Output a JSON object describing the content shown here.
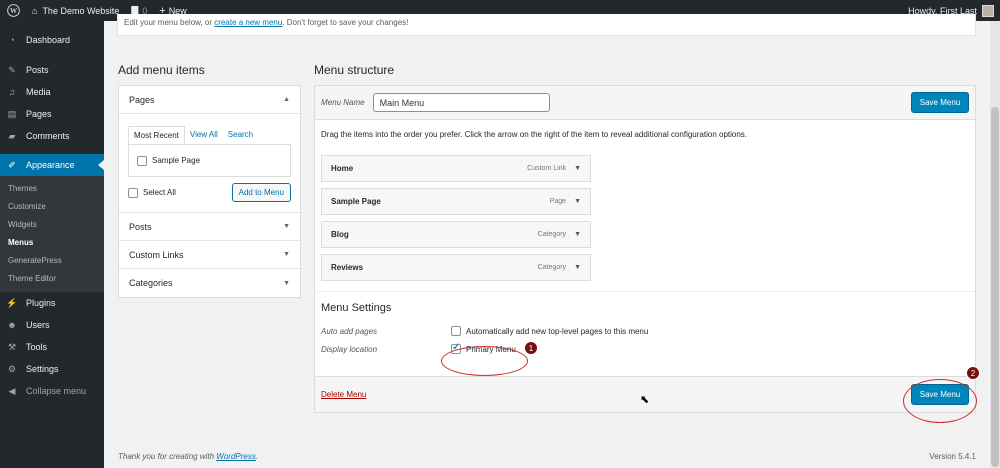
{
  "adminbar": {
    "wp_logo_icon": "wordpress-logo-icon",
    "site_name": "The Demo Website",
    "comments_count": "0",
    "new_label": "New",
    "howdy": "Howdy, First Last"
  },
  "sidebar": {
    "items": [
      {
        "label": "Dashboard",
        "icon": "dashboard-icon"
      },
      {
        "label": "Posts",
        "icon": "pin-icon"
      },
      {
        "label": "Media",
        "icon": "media-icon"
      },
      {
        "label": "Pages",
        "icon": "page-icon"
      },
      {
        "label": "Comments",
        "icon": "comment-icon"
      },
      {
        "label": "Appearance",
        "icon": "brush-icon"
      },
      {
        "label": "Plugins",
        "icon": "plugin-icon"
      },
      {
        "label": "Users",
        "icon": "user-icon"
      },
      {
        "label": "Tools",
        "icon": "wrench-icon"
      },
      {
        "label": "Settings",
        "icon": "settings-icon"
      },
      {
        "label": "Collapse menu",
        "icon": "collapse-icon"
      }
    ],
    "submenu": [
      "Themes",
      "Customize",
      "Widgets",
      "Menus",
      "GeneratePress",
      "Theme Editor"
    ]
  },
  "topbox": {
    "text_before": "Edit your menu below, or ",
    "link": "create a new menu",
    "text_after": ". Don't forget to save your changes!"
  },
  "add_items": {
    "title": "Add menu items",
    "pages_label": "Pages",
    "tabs": [
      "Most Recent",
      "View All",
      "Search"
    ],
    "page_item": "Sample Page",
    "select_all": "Select All",
    "add_button": "Add to Menu",
    "sections": [
      "Posts",
      "Custom Links",
      "Categories"
    ]
  },
  "structure": {
    "title": "Menu structure",
    "menu_name_label": "Menu Name",
    "menu_name_value": "Main Menu",
    "save_button": "Save Menu",
    "instructions": "Drag the items into the order you prefer. Click the arrow on the right of the item to reveal additional configuration options.",
    "items": [
      {
        "name": "Home",
        "type": "Custom Link"
      },
      {
        "name": "Sample Page",
        "type": "Page"
      },
      {
        "name": "Blog",
        "type": "Category"
      },
      {
        "name": "Reviews",
        "type": "Category"
      }
    ],
    "settings_title": "Menu Settings",
    "auto_add_label": "Auto add pages",
    "auto_add_text": "Automatically add new top-level pages to this menu",
    "display_location_label": "Display location",
    "primary_menu": "Primary Menu",
    "primary_checked": true,
    "delete_link": "Delete Menu"
  },
  "annotations": [
    "1",
    "2"
  ],
  "footer": {
    "thanks_before": "Thank you for creating with ",
    "wordpress_link": "WordPress",
    "thanks_after": ".",
    "version": "Version 5.4.1"
  }
}
